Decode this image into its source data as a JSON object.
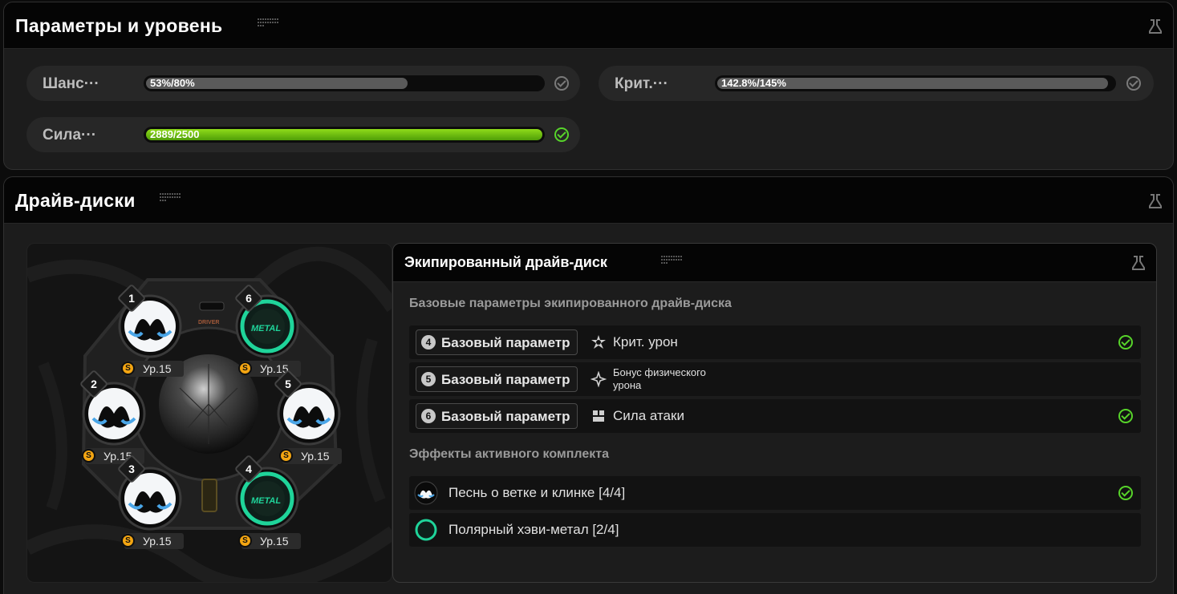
{
  "params_panel": {
    "title": "Параметры и уровень",
    "stats": [
      {
        "name": "Шанс···",
        "value_text": "53%/80%",
        "fill": 0.66,
        "met": false
      },
      {
        "name": "Крит.···",
        "value_text": "142.8%/145%",
        "fill": 0.985,
        "met": false
      },
      {
        "name": "Сила···",
        "value_text": "2889/2500",
        "fill": 1.0,
        "met": true
      }
    ]
  },
  "drive_panel": {
    "title": "Драйв-диски",
    "disc_slots": [
      {
        "slot": "1",
        "level": "Ур.15",
        "type": "white-disc"
      },
      {
        "slot": "6",
        "level": "Ур.15",
        "type": "green-disc"
      },
      {
        "slot": "2",
        "level": "Ур.15",
        "type": "white-disc"
      },
      {
        "slot": "5",
        "level": "Ур.15",
        "type": "white-disc"
      },
      {
        "slot": "3",
        "level": "Ур.15",
        "type": "white-disc"
      },
      {
        "slot": "4",
        "level": "Ур.15",
        "type": "green-disc"
      }
    ],
    "driver_label": "DRIVER",
    "equipped": {
      "title": "Экипированный драйв-диск",
      "base_title": "Базовые параметры экипированного драйв-диска",
      "base_rows": [
        {
          "num": "4",
          "label": "Базовый параметр",
          "icon": "crit-dmg-icon",
          "value": "Крит. урон",
          "met": true
        },
        {
          "num": "5",
          "label": "Базовый параметр",
          "icon": "phys-bonus-icon",
          "value": "Бонус физического урона",
          "met": false
        },
        {
          "num": "6",
          "label": "Базовый параметр",
          "icon": "atk-icon",
          "value": "Сила атаки",
          "met": true
        }
      ],
      "set_title": "Эффекты активного комплекта",
      "sets": [
        {
          "name": "Песнь о ветке и клинке [4/4]",
          "icon": "branch-blade-set-icon",
          "met": true
        },
        {
          "name": "Полярный хэви-метал [2/4]",
          "icon": "polar-metal-set-icon",
          "met": false
        }
      ]
    }
  },
  "colors": {
    "accent_green": "#57d42a",
    "coin": "#f3a512",
    "disc_green": "#1fd49a"
  }
}
